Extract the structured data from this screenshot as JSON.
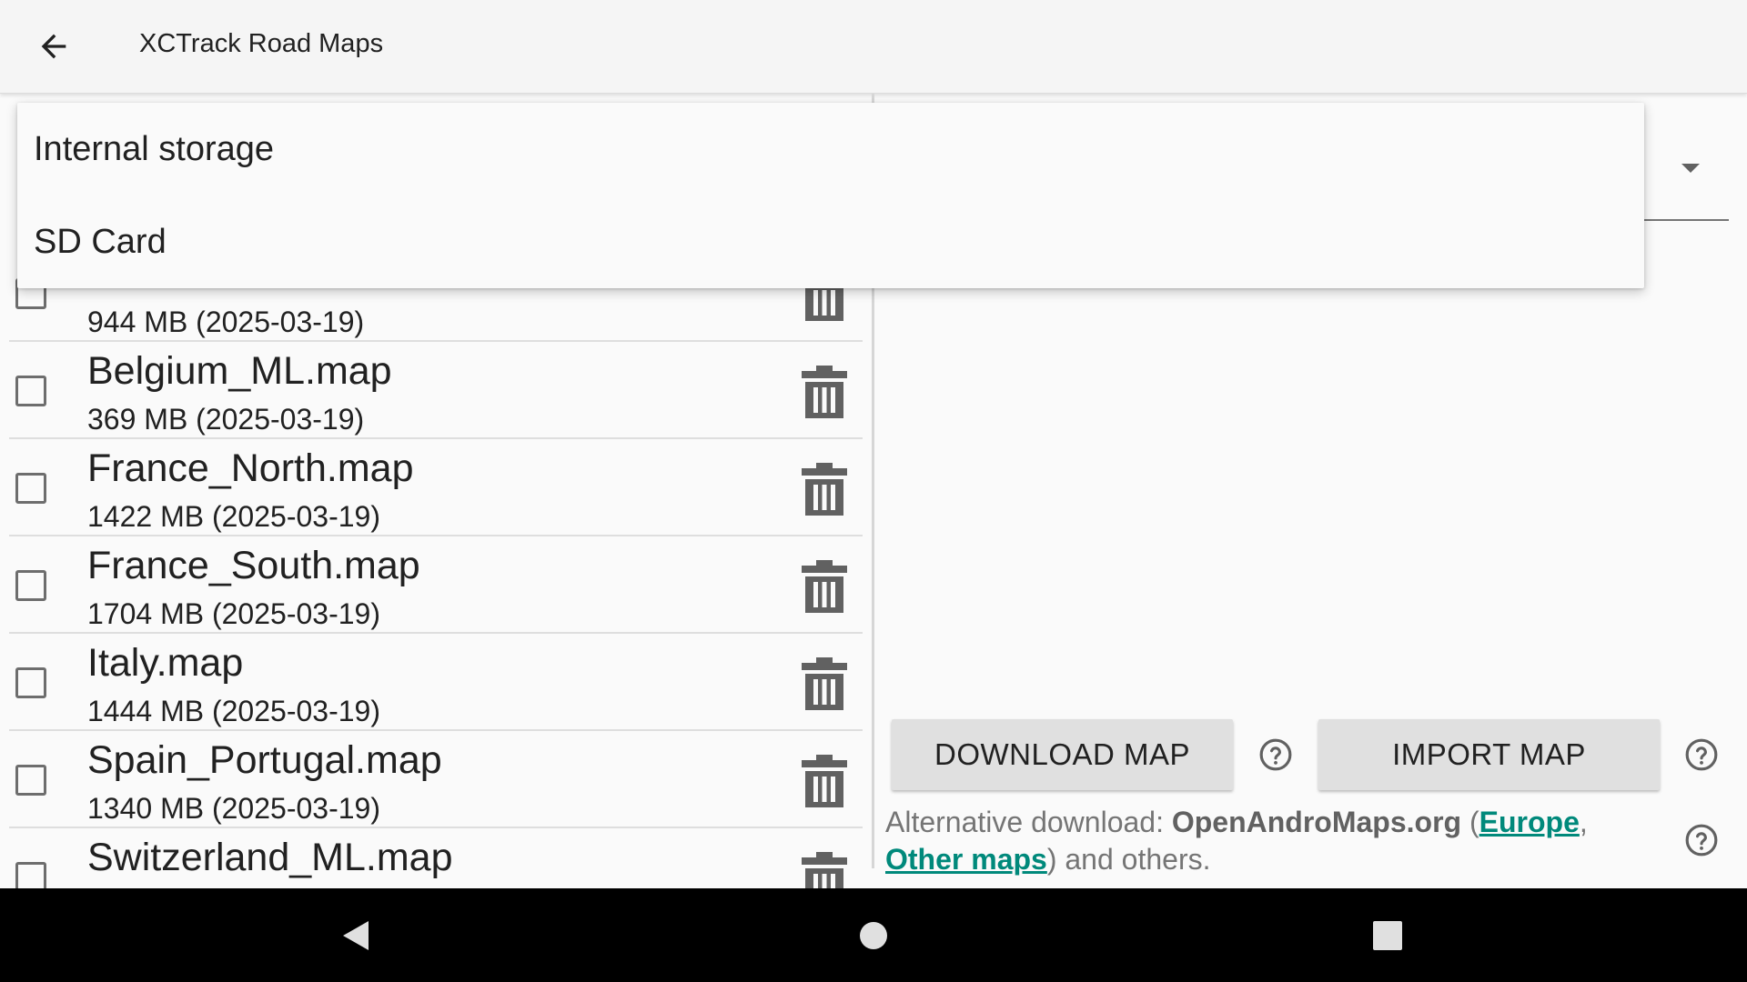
{
  "app_bar": {
    "title": "XCTrack Road Maps"
  },
  "storage_popup": {
    "options": [
      "Internal storage",
      "SD Card"
    ]
  },
  "maps": [
    {
      "name": "",
      "size": "944 MB (2025-03-19)"
    },
    {
      "name": "Belgium_ML.map",
      "size": "369 MB (2025-03-19)"
    },
    {
      "name": "France_North.map",
      "size": "1422 MB (2025-03-19)"
    },
    {
      "name": "France_South.map",
      "size": "1704 MB (2025-03-19)"
    },
    {
      "name": "Italy.map",
      "size": "1444 MB (2025-03-19)"
    },
    {
      "name": "Spain_Portugal.map",
      "size": "1340 MB (2025-03-19)"
    },
    {
      "name": "Switzerland_ML.map",
      "size": ""
    }
  ],
  "actions": {
    "download_label": "DOWNLOAD MAP",
    "import_label": "IMPORT MAP"
  },
  "alt_download": {
    "prefix": "Alternative download: ",
    "site": "OpenAndroMaps.org",
    "open_paren": " (",
    "europe_link": "Europe",
    "comma": ",",
    "other_link": "Other maps",
    "suffix": ") and others."
  },
  "icons": {
    "back": "arrow-back-icon",
    "delete": "trash-icon",
    "help": "help-circle-icon",
    "dropdown": "caret-down-icon",
    "nav_back": "triangle-back-icon",
    "nav_home": "circle-home-icon",
    "nav_recents": "square-recents-icon"
  },
  "colors": {
    "link": "#00897b",
    "button_bg": "#e0e0e0",
    "icon_gray": "#616161",
    "navbar": "#000000"
  }
}
